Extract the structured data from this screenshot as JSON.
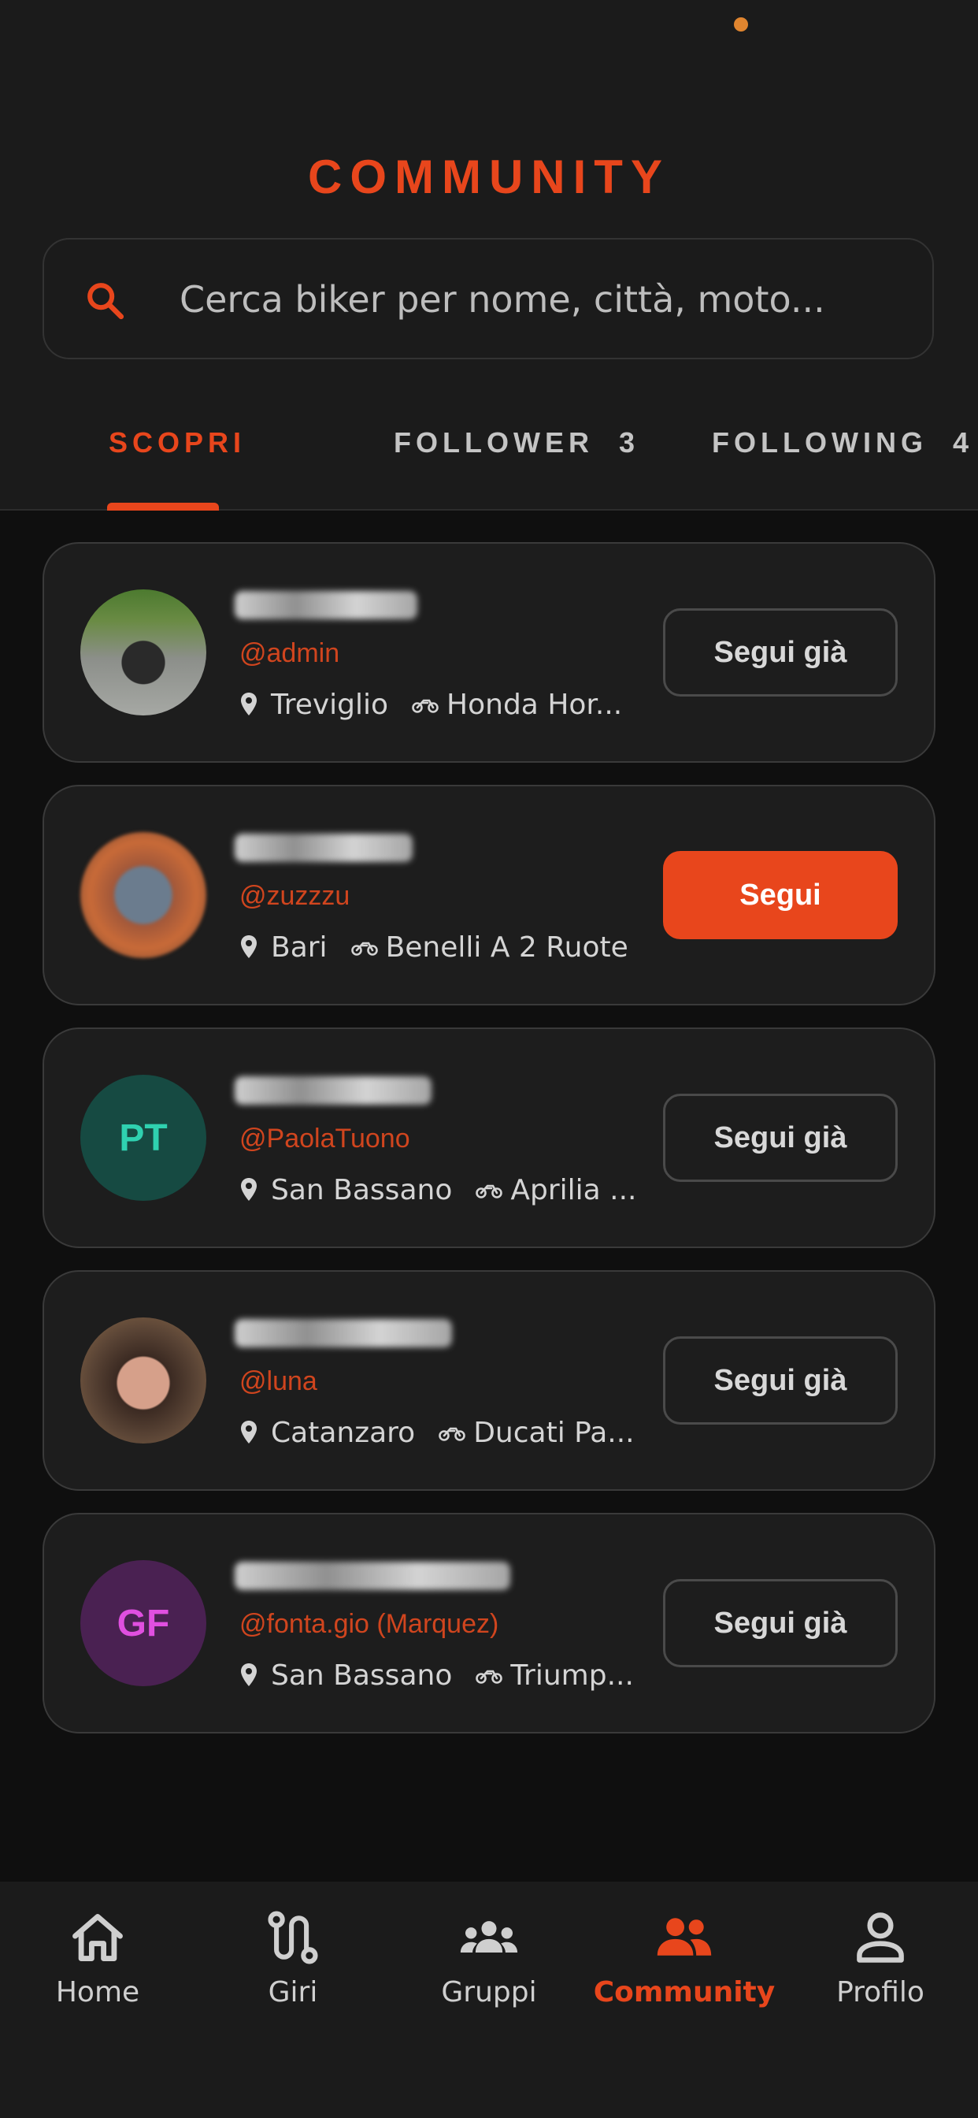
{
  "header": {
    "title": "COMMUNITY"
  },
  "search": {
    "placeholder": "Cerca biker per nome, città, moto..."
  },
  "tabs": [
    {
      "label": "SCOPRI",
      "active": true
    },
    {
      "label": "FOLLOWER  3",
      "active": false
    },
    {
      "label": "FOLLOWING  4",
      "active": false
    }
  ],
  "users": [
    {
      "handle": "@admin",
      "city": "Treviglio",
      "bike": "Honda Hor...",
      "button": "Segui già",
      "avatar": "photo"
    },
    {
      "handle": "@zuzzzu",
      "city": "Bari",
      "bike": "Benelli A 2 Ruote",
      "button": "Segui",
      "avatar": "photo"
    },
    {
      "handle": "@PaolaTuono",
      "city": "San Bassano",
      "bike": "Aprilia ...",
      "button": "Segui già",
      "avatar": "initials",
      "initials": "PT"
    },
    {
      "handle": "@luna",
      "city": "Catanzaro",
      "bike": "Ducati Pa...",
      "button": "Segui già",
      "avatar": "photo"
    },
    {
      "handle": "@fonta.gio (Marquez)",
      "city": "San Bassano",
      "bike": "Triump...",
      "button": "Segui già",
      "avatar": "initials",
      "initials": "GF"
    }
  ],
  "nav": {
    "items": [
      {
        "label": "Home",
        "icon": "home-icon",
        "active": false
      },
      {
        "label": "Giri",
        "icon": "route-icon",
        "active": false
      },
      {
        "label": "Gruppi",
        "icon": "groups-icon",
        "active": false
      },
      {
        "label": "Community",
        "icon": "community-icon",
        "active": true
      },
      {
        "label": "Profilo",
        "icon": "profile-icon",
        "active": false
      }
    ]
  },
  "colors": {
    "accent": "#e8461c",
    "background": "#0f0f0f",
    "surface": "#1d1d1d",
    "avatar_pt_bg": "#164a42",
    "avatar_pt_fg": "#2fd1b0",
    "avatar_gf_bg": "#4a2152",
    "avatar_gf_fg": "#e04fe0"
  }
}
